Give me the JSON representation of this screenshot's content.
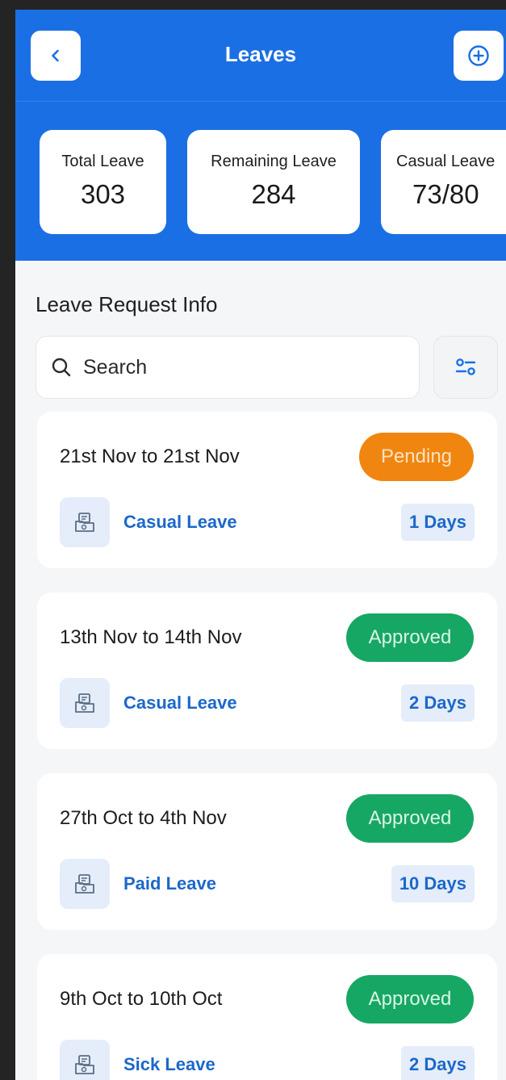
{
  "header": {
    "title": "Leaves",
    "back_icon": "chevron-left-icon",
    "add_icon": "plus-circle-icon",
    "color": "#1b6fe4"
  },
  "stats": [
    {
      "label": "Total Leave",
      "value": "303"
    },
    {
      "label": "Remaining Leave",
      "value": "284"
    },
    {
      "label": "Casual Leave",
      "value": "73/80"
    }
  ],
  "section_title": "Leave Request Info",
  "search": {
    "placeholder": "Search",
    "icon": "search-icon"
  },
  "filter_icon": "filter-sliders-icon",
  "leave_requests": [
    {
      "date_range": "21st Nov to 21st Nov",
      "status": "Pending",
      "type": "Casual Leave",
      "duration": "1 Days"
    },
    {
      "date_range": "13th Nov to 14th Nov",
      "status": "Approved",
      "type": "Casual Leave",
      "duration": "2 Days"
    },
    {
      "date_range": "27th Oct to 4th Nov",
      "status": "Approved",
      "type": "Paid Leave",
      "duration": "10 Days"
    },
    {
      "date_range": "9th Oct to 10th Oct",
      "status": "Approved",
      "type": "Sick Leave",
      "duration": "2 Days"
    }
  ],
  "colors": {
    "pending": "#f0860f",
    "approved": "#17a764",
    "link": "#1c68c9"
  }
}
